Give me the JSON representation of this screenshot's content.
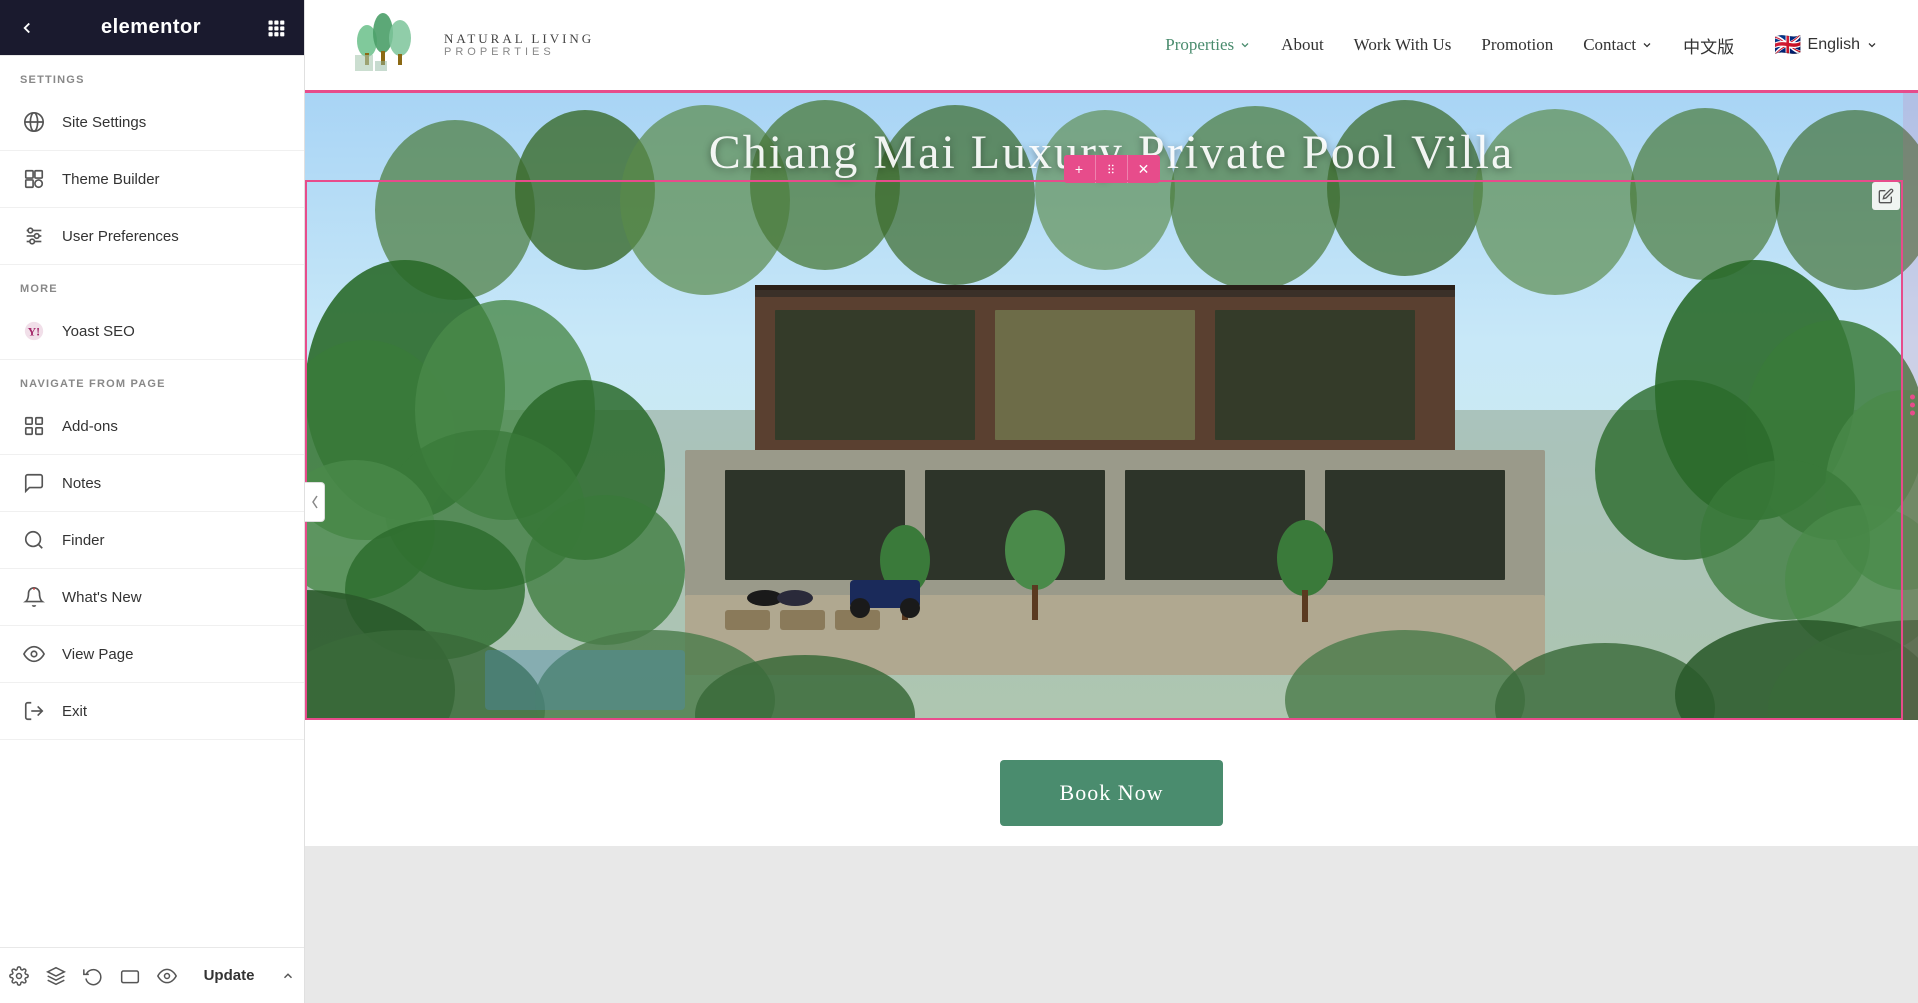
{
  "sidebar": {
    "header": {
      "back_icon": "◀",
      "logo_text": "elementor",
      "grid_icon": "⊞"
    },
    "settings_label": "SETTINGS",
    "settings_items": [
      {
        "id": "site-settings",
        "label": "Site Settings",
        "icon": "globe"
      },
      {
        "id": "theme-builder",
        "label": "Theme Builder",
        "icon": "theme"
      },
      {
        "id": "user-preferences",
        "label": "User Preferences",
        "icon": "sliders"
      }
    ],
    "more_label": "MORE",
    "more_items": [
      {
        "id": "yoast-seo",
        "label": "Yoast SEO",
        "icon": "yoast"
      }
    ],
    "navigate_label": "NAVIGATE FROM PAGE",
    "navigate_items": [
      {
        "id": "add-ons",
        "label": "Add-ons",
        "icon": "addons"
      },
      {
        "id": "notes",
        "label": "Notes",
        "icon": "notes"
      },
      {
        "id": "finder",
        "label": "Finder",
        "icon": "finder"
      },
      {
        "id": "whats-new",
        "label": "What's New",
        "icon": "whats-new"
      },
      {
        "id": "view-page",
        "label": "View Page",
        "icon": "view"
      },
      {
        "id": "exit",
        "label": "Exit",
        "icon": "exit"
      }
    ],
    "footer": {
      "settings_icon": "⚙",
      "layers_icon": "☰",
      "history_icon": "↺",
      "responsive_icon": "▭",
      "preview_icon": "👁",
      "update_label": "Update",
      "chevron_icon": "∧"
    }
  },
  "canvas": {
    "nav": {
      "logo_name": "Natural Living",
      "logo_sub": "Properties",
      "menu_items": [
        {
          "id": "properties",
          "label": "Properties",
          "active": true,
          "has_arrow": true
        },
        {
          "id": "about",
          "label": "About",
          "active": false
        },
        {
          "id": "work-with-us",
          "label": "Work With Us",
          "active": false
        },
        {
          "id": "promotion",
          "label": "Promotion",
          "active": false
        },
        {
          "id": "contact",
          "label": "Contact",
          "active": false,
          "has_arrow": true
        },
        {
          "id": "chinese",
          "label": "中文版",
          "active": false
        }
      ],
      "flag_emoji": "🇬🇧",
      "language": "English"
    },
    "hero": {
      "title": "Chiang Mai Luxury Private Pool Villa",
      "bg_description": "Aerial view of luxury villa surrounded by tropical greenery"
    },
    "book_now": {
      "button_label": "Book Now"
    }
  }
}
